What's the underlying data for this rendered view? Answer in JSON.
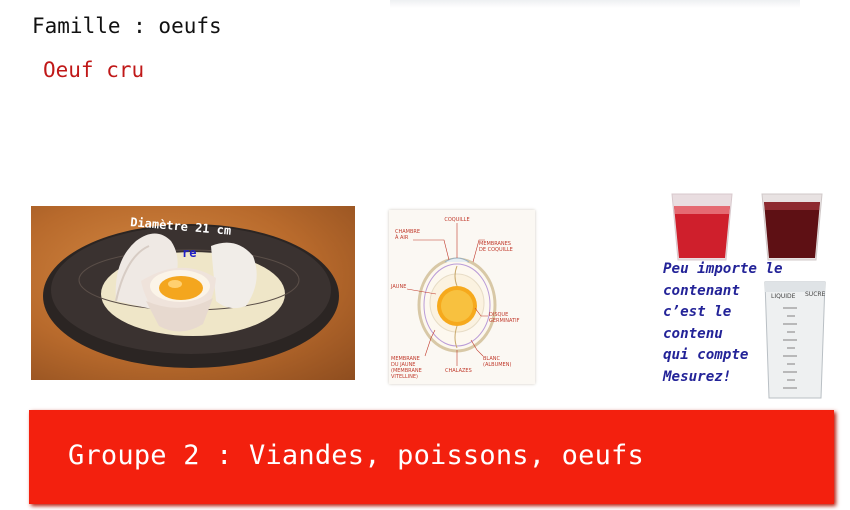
{
  "header": {
    "family": "Famille : oeufs",
    "subtitle": "Oeuf cru"
  },
  "photo": {
    "diameter_text": "Diamètre 21 cm",
    "fragment_text": "re"
  },
  "diagram": {
    "labels": {
      "coquille": "COQUILLE",
      "chambre1": "CHAMBRE",
      "chambre2": "À AIR",
      "membranes1": "MEMBRANES",
      "membranes2": "DE COQUILLE",
      "jaune": "JAUNE",
      "disque1": "DISQUE",
      "disque2": "GERMINATIF",
      "mvit1": "MEMBRANE",
      "mvit2": "DU JAUNE",
      "mvit3": "(MEMBRANE",
      "mvit4": "VITELLINE)",
      "chalazes": "CHALAZES",
      "blanc1": "BLANC",
      "blanc2": "(ALBUMEN)"
    }
  },
  "measure": {
    "jug_label_left": "LIQUIDE",
    "jug_label_right": "SUCRE"
  },
  "message": {
    "lines": [
      "Peu importe le",
      "contenant",
      "c’est le",
      "contenu",
      "qui compte",
      "Mesurez!"
    ]
  },
  "banner": {
    "text": "Groupe 2 : Viandes, poissons, oeufs"
  },
  "colors": {
    "banner": "#f3200e",
    "subtitle": "#c01818",
    "message": "#232398"
  }
}
